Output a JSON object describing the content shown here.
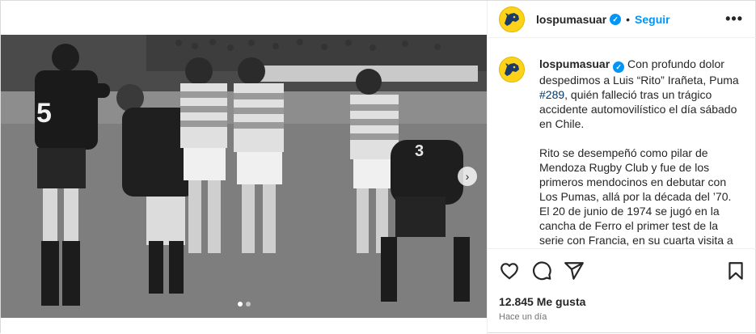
{
  "post": {
    "username": "lospumasuar",
    "follow_label": "Seguir",
    "separator": "•",
    "more_label": "•••"
  },
  "caption": {
    "username": "lospumasuar",
    "p1_a": " Con profundo dolor despedimos a Luis “Rito” Irañeta, Puma ",
    "mention": "#289",
    "p1_b": ", quién falleció tras un trágico accidente automovilístico el día sábado en Chile.",
    "p2": "Rito se desempeñó como pilar de Mendoza Rugby Club y fue de los primeros mendocinos en debutar con Los Pumas, allá por la década del ’70. El 20 de junio de 1974 se jugó en la cancha de Ferro el primer test de la serie con Francia, en su cuarta visita a"
  },
  "photo": {
    "jersey_number_left": "5",
    "jersey_number_right": "3"
  },
  "carousel": {
    "next_label": "›",
    "slides": 2,
    "active": 1
  },
  "actions": {
    "likes": "12.845 Me gusta",
    "time": "Hace un día"
  },
  "colors": {
    "accent": "#0095f6",
    "avatar_bg": "#ffd21a",
    "text": "#262626",
    "muted": "#737373"
  },
  "icons": [
    "verified-badge-icon",
    "more-options-icon",
    "heart-icon",
    "comment-icon",
    "share-icon",
    "save-bookmark-icon",
    "puma-logo-icon",
    "chevron-right-icon"
  ]
}
